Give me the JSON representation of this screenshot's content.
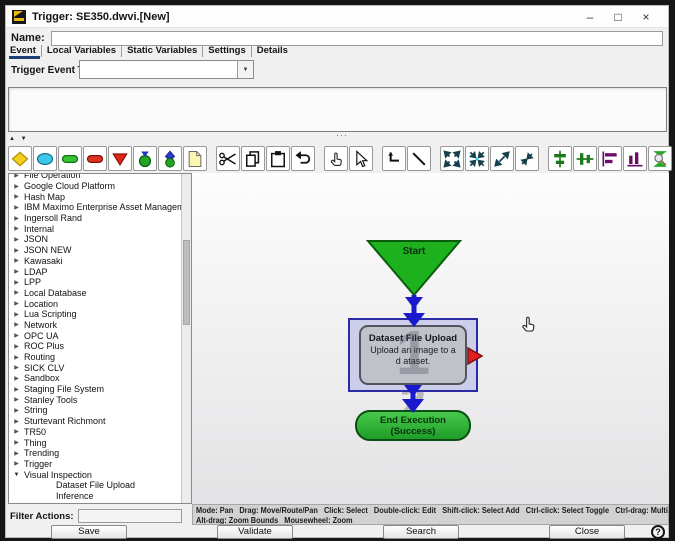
{
  "window": {
    "title": "Trigger: SE350.dwvi.[New]",
    "controls": {
      "minimize": "–",
      "maximize": "□",
      "close": "×"
    }
  },
  "form": {
    "name_label": "Name:",
    "name_value": "",
    "tabs": [
      {
        "label": "Event",
        "active": true
      },
      {
        "label": "Local Variables",
        "active": false
      },
      {
        "label": "Static Variables",
        "active": false
      },
      {
        "label": "Settings",
        "active": false
      },
      {
        "label": "Details",
        "active": false
      }
    ],
    "trigger_event_type_label": "Trigger Event Type:",
    "trigger_event_type_value": ""
  },
  "toolbar": {
    "palette_icons": [
      "diamond-node",
      "ellipse-node",
      "green-pill-node",
      "red-pill-node",
      "red-triangle-node",
      "event-circle-node",
      "pin-node",
      "note-page"
    ],
    "edit_icons": [
      "cut",
      "copy",
      "paste",
      "undo"
    ],
    "mode_icons": [
      "pan-hand",
      "select-cursor"
    ],
    "connector_icons": [
      "elbow-connector",
      "straight-connector"
    ],
    "view_icons": [
      "expand-all",
      "collapse-all",
      "zoom-in-diagonal",
      "zoom-out-diagonal"
    ],
    "align_icons": [
      "align-center-horizontal",
      "align-center-vertical",
      "align-left",
      "align-bottom",
      "zoom-to-bounds"
    ]
  },
  "tree": {
    "items": [
      {
        "label": "File Operation",
        "level": 0,
        "state": "collapsed"
      },
      {
        "label": "Google Cloud Platform",
        "level": 0,
        "state": "collapsed"
      },
      {
        "label": "Hash Map",
        "level": 0,
        "state": "collapsed"
      },
      {
        "label": "IBM Maximo Enterprise Asset Management",
        "level": 0,
        "state": "collapsed"
      },
      {
        "label": "Ingersoll Rand",
        "level": 0,
        "state": "collapsed"
      },
      {
        "label": "Internal",
        "level": 0,
        "state": "collapsed"
      },
      {
        "label": "JSON",
        "level": 0,
        "state": "collapsed"
      },
      {
        "label": "JSON NEW",
        "level": 0,
        "state": "collapsed"
      },
      {
        "label": "Kawasaki",
        "level": 0,
        "state": "collapsed"
      },
      {
        "label": "LDAP",
        "level": 0,
        "state": "collapsed"
      },
      {
        "label": "LPP",
        "level": 0,
        "state": "collapsed"
      },
      {
        "label": "Local Database",
        "level": 0,
        "state": "collapsed"
      },
      {
        "label": "Location",
        "level": 0,
        "state": "collapsed"
      },
      {
        "label": "Lua Scripting",
        "level": 0,
        "state": "collapsed"
      },
      {
        "label": "Network",
        "level": 0,
        "state": "collapsed"
      },
      {
        "label": "OPC UA",
        "level": 0,
        "state": "collapsed"
      },
      {
        "label": "ROC Plus",
        "level": 0,
        "state": "collapsed"
      },
      {
        "label": "Routing",
        "level": 0,
        "state": "collapsed"
      },
      {
        "label": "SICK CLV",
        "level": 0,
        "state": "collapsed"
      },
      {
        "label": "Sandbox",
        "level": 0,
        "state": "collapsed"
      },
      {
        "label": "Staging File System",
        "level": 0,
        "state": "collapsed"
      },
      {
        "label": "Stanley Tools",
        "level": 0,
        "state": "collapsed"
      },
      {
        "label": "String",
        "level": 0,
        "state": "collapsed"
      },
      {
        "label": "Sturtevant Richmont",
        "level": 0,
        "state": "collapsed"
      },
      {
        "label": "TR50",
        "level": 0,
        "state": "collapsed"
      },
      {
        "label": "Thing",
        "level": 0,
        "state": "collapsed"
      },
      {
        "label": "Trending",
        "level": 0,
        "state": "collapsed"
      },
      {
        "label": "Trigger",
        "level": 0,
        "state": "collapsed"
      },
      {
        "label": "Visual Inspection",
        "level": 0,
        "state": "expanded"
      },
      {
        "label": "Dataset File Upload",
        "level": 1,
        "state": "leaf"
      },
      {
        "label": "Inference",
        "level": 1,
        "state": "leaf"
      }
    ]
  },
  "canvas": {
    "start_label": "Start",
    "action_title": "Dataset File Upload",
    "action_description": "Upload an image to a d ataset.",
    "action_watermark": "1",
    "end_label": "End Execution (Success)",
    "end_watermark": "2"
  },
  "status_bar": {
    "line1": "Mode: Pan   Drag: Move/Route/Pan   Click: Select   Double-click: Edit   Shift-click: Select Add   Ctrl-click: Select Toggle   Ctrl-drag: Multi-select",
    "line2": "Alt-drag: Zoom Bounds   Mousewheel: Zoom"
  },
  "filter": {
    "label": "Filter Actions:",
    "value": ""
  },
  "footer": {
    "buttons": [
      "Save",
      "Validate",
      "Search",
      "Close"
    ],
    "help": "?"
  },
  "colors": {
    "start_node": "#1db21d",
    "end_node": "#2aab2f",
    "arrow": "#1a1acc",
    "selection_border": "#2b2ba6",
    "selection_fill": "#c9cbe9",
    "action_node_fill": "#c1c1c9",
    "port_triangle": "#e02020",
    "tab_underline": "#1d3f73"
  }
}
